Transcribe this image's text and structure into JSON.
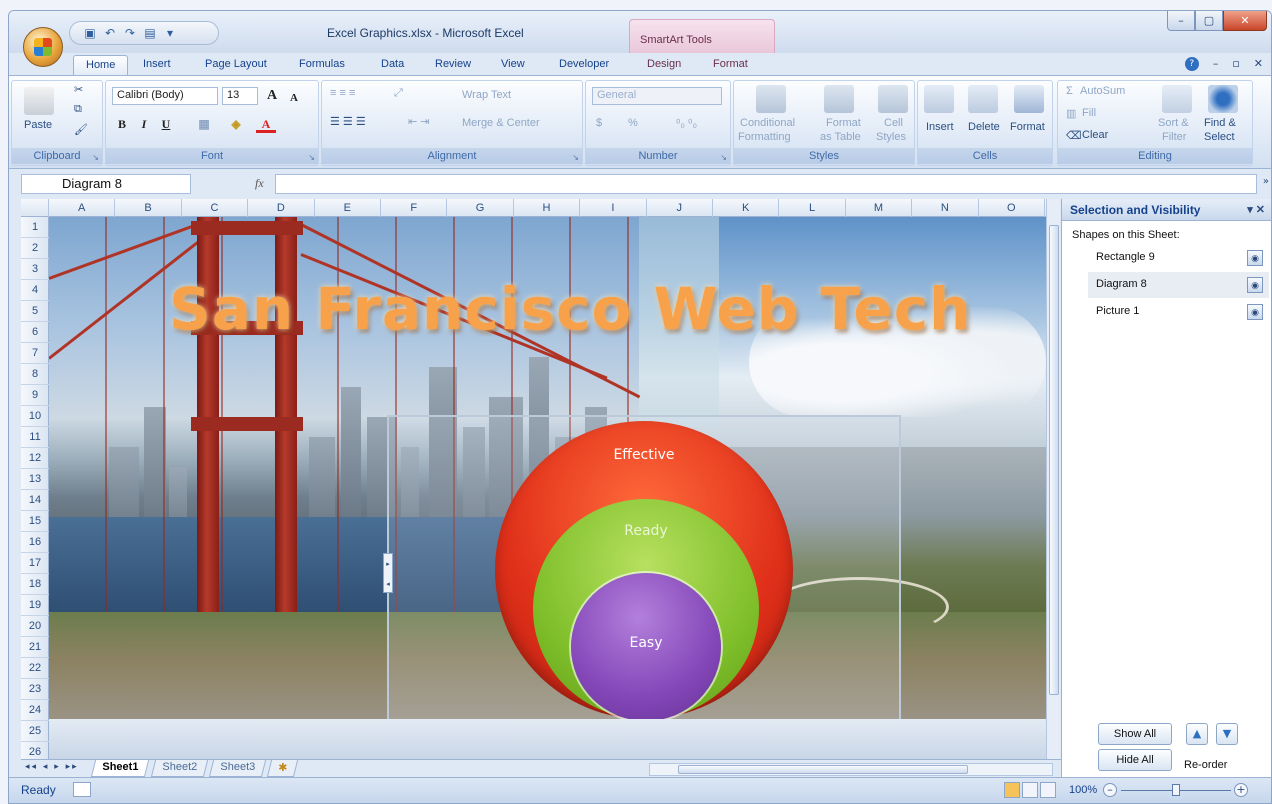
{
  "window": {
    "title": "Excel Graphics.xlsx - Microsoft Excel",
    "context_tools": "SmartArt Tools"
  },
  "tabs": [
    "Home",
    "Insert",
    "Page Layout",
    "Formulas",
    "Data",
    "Review",
    "View",
    "Developer",
    "Design",
    "Format"
  ],
  "ribbon": {
    "clipboard": {
      "paste": "Paste",
      "label": "Clipboard"
    },
    "font": {
      "name": "Calibri (Body)",
      "size": "13",
      "bold": "B",
      "italic": "I",
      "underline": "U",
      "grow": "A",
      "shrink": "A",
      "label": "Font"
    },
    "alignment": {
      "wrap": "Wrap Text",
      "merge": "Merge & Center",
      "label": "Alignment"
    },
    "number": {
      "format": "General",
      "currency": "$",
      "percent": "%",
      "label": "Number"
    },
    "styles": {
      "conditional": "Conditional",
      "conditional2": "Formatting",
      "format_table": "Format",
      "format_table2": "as Table",
      "cell_styles": "Cell",
      "cell_styles2": "Styles",
      "label": "Styles"
    },
    "cells": {
      "insert": "Insert",
      "delete": "Delete",
      "format": "Format",
      "label": "Cells"
    },
    "editing": {
      "autosum": "AutoSum",
      "fill": "Fill",
      "clear": "Clear",
      "sort": "Sort &",
      "sort2": "Filter",
      "find": "Find &",
      "find2": "Select",
      "label": "Editing"
    }
  },
  "formula_bar": {
    "name_box": "Diagram 8",
    "fx": "fx",
    "content": ""
  },
  "columns": [
    "A",
    "B",
    "C",
    "D",
    "E",
    "F",
    "G",
    "H",
    "I",
    "J",
    "K",
    "L",
    "M",
    "N",
    "O"
  ],
  "rows": [
    "1",
    "2",
    "3",
    "4",
    "5",
    "6",
    "7",
    "8",
    "9",
    "10",
    "11",
    "12",
    "13",
    "14",
    "15",
    "16",
    "17",
    "18",
    "19",
    "20",
    "21",
    "22",
    "23",
    "24",
    "25",
    "26"
  ],
  "wordart": "San Francisco Web Tech",
  "diagram": {
    "outer": "Effective",
    "middle": "Ready",
    "inner": "Easy"
  },
  "sheets": [
    "Sheet1",
    "Sheet2",
    "Sheet3"
  ],
  "pane": {
    "title": "Selection and Visibility",
    "subtitle": "Shapes on this Sheet:",
    "shapes": [
      "Rectangle 9",
      "Diagram 8",
      "Picture 1"
    ],
    "show_all": "Show All",
    "hide_all": "Hide All",
    "reorder": "Re-order"
  },
  "status": {
    "mode": "Ready",
    "zoom": "100%"
  }
}
